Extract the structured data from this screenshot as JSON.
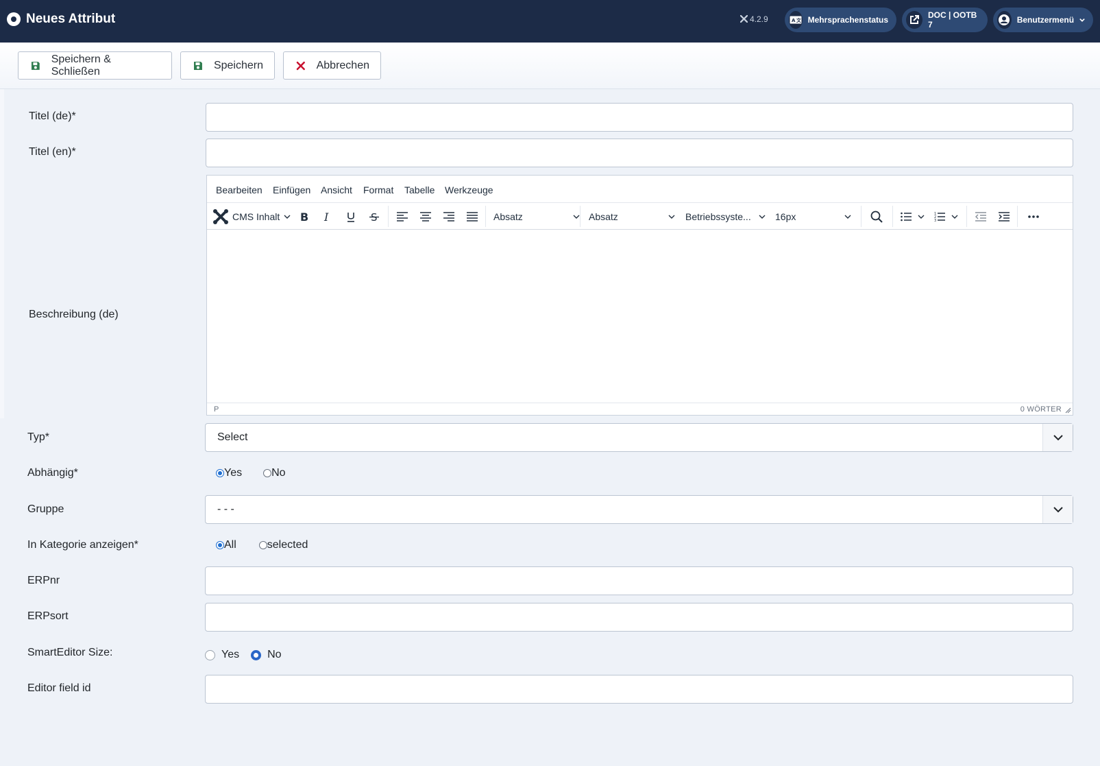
{
  "header": {
    "title": "Neues Attribut",
    "version": "4.2.9",
    "multilang_label": "Mehrsprachenstatus",
    "site_label": "DOC | OOTB 7",
    "user_menu_label": "Benutzermenü"
  },
  "toolbar": {
    "save_close_label": "Speichern & Schließen",
    "save_label": "Speichern",
    "cancel_label": "Abbrechen"
  },
  "form": {
    "title_de_label": "Titel (de)*",
    "title_de_value": "",
    "title_en_label": "Titel (en)*",
    "title_en_value": "",
    "description_label": "Beschreibung (de)",
    "type_label": "Typ*",
    "type_value": "Select",
    "dependent_label": "Abhängig*",
    "dependent_options": [
      "Yes",
      "No"
    ],
    "dependent_selected": "Yes",
    "group_label": "Gruppe",
    "group_value": "- - -",
    "show_in_category_label": "In Kategorie anzeigen*",
    "show_in_category_options": [
      "All",
      "selected"
    ],
    "show_in_category_selected": "All",
    "erpnr_label": "ERPnr",
    "erpnr_value": "",
    "erpsort_label": "ERPsort",
    "erpsort_value": "",
    "smarteditor_label": "SmartEditor Size:",
    "smarteditor_options": [
      "Yes",
      "No"
    ],
    "smarteditor_selected": "No",
    "editor_field_label": "Editor field id",
    "editor_field_value": ""
  },
  "editor": {
    "menu": [
      "Bearbeiten",
      "Einfügen",
      "Ansicht",
      "Format",
      "Tabelle",
      "Werkzeuge"
    ],
    "cms_content_label": "CMS Inhalt",
    "block_format_1": "Absatz",
    "block_format_2": "Absatz",
    "font_family": "Betriebssyste...",
    "font_size": "16px",
    "status_path": "P",
    "word_count": "0 WÖRTER"
  },
  "colors": {
    "header_bg": "#1c2b47",
    "pill_bg": "#2e4a74",
    "save_icon": "#2f7d4f",
    "cancel_icon": "#c8102e",
    "radio_accent": "#1f6fd1"
  }
}
